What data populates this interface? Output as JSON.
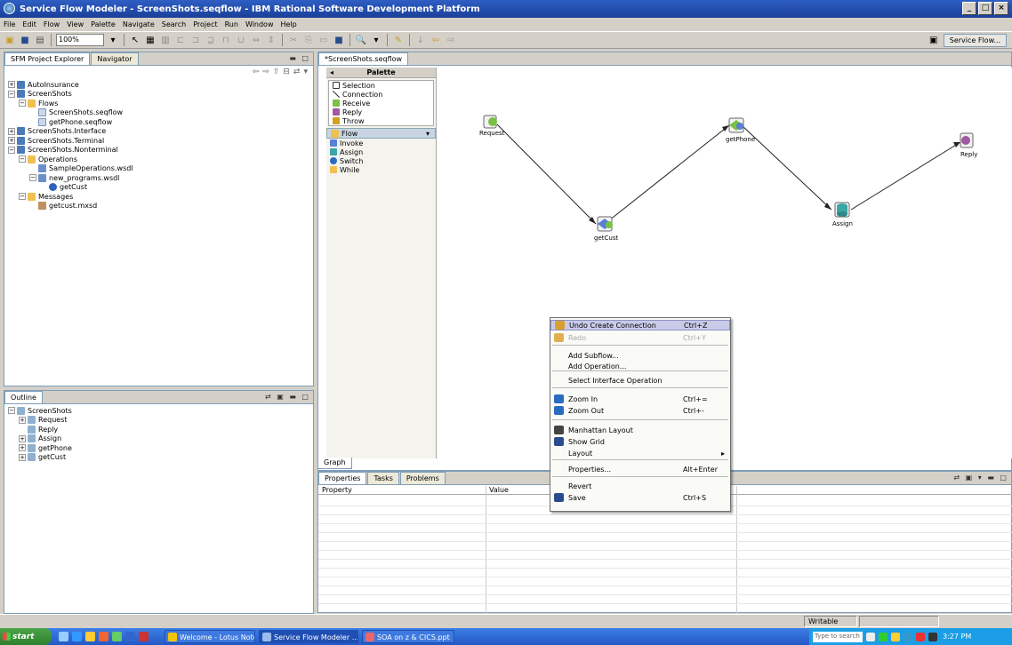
{
  "window": {
    "title": "Service Flow Modeler - ScreenShots.seqflow - IBM Rational Software Development Platform"
  },
  "menu": [
    "File",
    "Edit",
    "Flow",
    "View",
    "Palette",
    "Navigate",
    "Search",
    "Project",
    "Run",
    "Window",
    "Help"
  ],
  "toolbar": {
    "zoom": "100%",
    "perspective": "Service Flow..."
  },
  "explorer": {
    "tabs": [
      "SFM Project Explorer",
      "Navigator"
    ],
    "tree": [
      {
        "indent": 0,
        "tw": "+",
        "icon": "proj",
        "label": "AutoInsurance"
      },
      {
        "indent": 0,
        "tw": "−",
        "icon": "proj",
        "label": "ScreenShots"
      },
      {
        "indent": 1,
        "tw": "−",
        "icon": "folder",
        "label": "Flows"
      },
      {
        "indent": 2,
        "tw": "",
        "icon": "file",
        "label": "ScreenShots.seqflow"
      },
      {
        "indent": 2,
        "tw": "",
        "icon": "file",
        "label": "getPhone.seqflow"
      },
      {
        "indent": 0,
        "tw": "+",
        "icon": "proj",
        "label": "ScreenShots.Interface"
      },
      {
        "indent": 0,
        "tw": "+",
        "icon": "proj",
        "label": "ScreenShots.Terminal"
      },
      {
        "indent": 0,
        "tw": "−",
        "icon": "proj",
        "label": "ScreenShots.Nonterminal"
      },
      {
        "indent": 1,
        "tw": "−",
        "icon": "folder",
        "label": "Operations"
      },
      {
        "indent": 2,
        "tw": "",
        "icon": "wsdl",
        "label": "SampleOperations.wsdl"
      },
      {
        "indent": 2,
        "tw": "−",
        "icon": "wsdl",
        "label": "new_programs.wsdl"
      },
      {
        "indent": 3,
        "tw": "",
        "icon": "op",
        "label": "getCust"
      },
      {
        "indent": 1,
        "tw": "−",
        "icon": "folder",
        "label": "Messages"
      },
      {
        "indent": 2,
        "tw": "",
        "icon": "xsd",
        "label": "getcust.mxsd"
      }
    ]
  },
  "outline": {
    "tab": "Outline",
    "tree": [
      {
        "indent": 0,
        "tw": "−",
        "icon": "node",
        "label": "ScreenShots"
      },
      {
        "indent": 1,
        "tw": "+",
        "icon": "node",
        "label": "Request"
      },
      {
        "indent": 1,
        "tw": "",
        "icon": "node",
        "label": "Reply"
      },
      {
        "indent": 1,
        "tw": "+",
        "icon": "node",
        "label": "Assign"
      },
      {
        "indent": 1,
        "tw": "+",
        "icon": "node",
        "label": "getPhone"
      },
      {
        "indent": 1,
        "tw": "+",
        "icon": "node",
        "label": "getCust"
      }
    ]
  },
  "editor": {
    "tab": "*ScreenShots.seqflow",
    "graph_tab": "Graph"
  },
  "palette": {
    "title": "Palette",
    "items": [
      "Selection",
      "Connection",
      "Receive",
      "Reply",
      "Throw"
    ],
    "drawer": "Flow",
    "flow_items": [
      "Invoke",
      "Assign",
      "Switch",
      "While"
    ]
  },
  "nodes": [
    {
      "label": "Request",
      "color": "#7ac143"
    },
    {
      "label": "getCust",
      "color": "#5a7fd6"
    },
    {
      "label": "getPhone",
      "color": "#7ac143"
    },
    {
      "label": "Assign",
      "color": "#3aa6a6"
    },
    {
      "label": "Reply",
      "color": "#7ac143"
    }
  ],
  "context_menu": [
    {
      "label": "Undo Create Connection",
      "shortcut": "Ctrl+Z",
      "highlight": true
    },
    {
      "label": "Redo",
      "shortcut": "Ctrl+Y",
      "disabled": true
    },
    {
      "label": "Add Subflow..."
    },
    {
      "label": "Add Operation..."
    },
    {
      "label": "Select Interface Operation"
    },
    {
      "label": "Zoom In",
      "shortcut": "Ctrl+="
    },
    {
      "label": "Zoom Out",
      "shortcut": "Ctrl+-"
    },
    {
      "label": "Manhattan Layout"
    },
    {
      "label": "Show Grid"
    },
    {
      "label": "Layout",
      "submenu": true
    },
    {
      "label": "Properties...",
      "shortcut": "Alt+Enter"
    },
    {
      "label": "Revert"
    },
    {
      "label": "Save",
      "shortcut": "Ctrl+S"
    }
  ],
  "properties": {
    "tabs": [
      "Properties",
      "Tasks",
      "Problems"
    ],
    "columns": [
      "Property",
      "Value"
    ]
  },
  "status": {
    "mode": "Writable"
  },
  "taskbar": {
    "start": "start",
    "tasks": [
      "Welcome - Lotus Notes",
      "Service Flow Modeler ...",
      "SOA on z & CICS.ppt"
    ],
    "search_placeholder": "Type to search",
    "clock": "3:27 PM"
  }
}
